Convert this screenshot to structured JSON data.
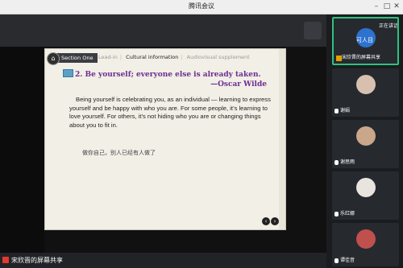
{
  "window": {
    "title": "腾讯会议"
  },
  "slide": {
    "nav": {
      "section": "Section One",
      "tabs": [
        "Lead-in",
        "Cultural information",
        "Audiovisual supplement"
      ]
    },
    "quote_line1": "2. Be yourself; everyone else is already taken.",
    "quote_author": "—Oscar Wilde",
    "paragraph": "Being yourself is celebrating you, as an individual — learning to express yourself and be happy with who you are. For some people, it’s learning to love yourself. For others, it’s not hiding who you are or changing things about you to fit in.",
    "chinese_line": "做你自己，别人已经有人做了"
  },
  "share_bar": {
    "label": "宋欣晋的屏幕共享"
  },
  "participants": {
    "speaking_text": "正在讲话: 宋",
    "tiles": [
      {
        "name": "宋欣晋的屏幕共享",
        "avatar_text": "可人目",
        "active": true
      },
      {
        "name": "谢娟",
        "avatar_text": ""
      },
      {
        "name": "谢思雨",
        "avatar_text": ""
      },
      {
        "name": "乐红娜",
        "avatar_text": ""
      },
      {
        "name": "谭佳音",
        "avatar_text": ""
      },
      {
        "name": "Ran华奕然",
        "avatar_text": ""
      }
    ]
  }
}
